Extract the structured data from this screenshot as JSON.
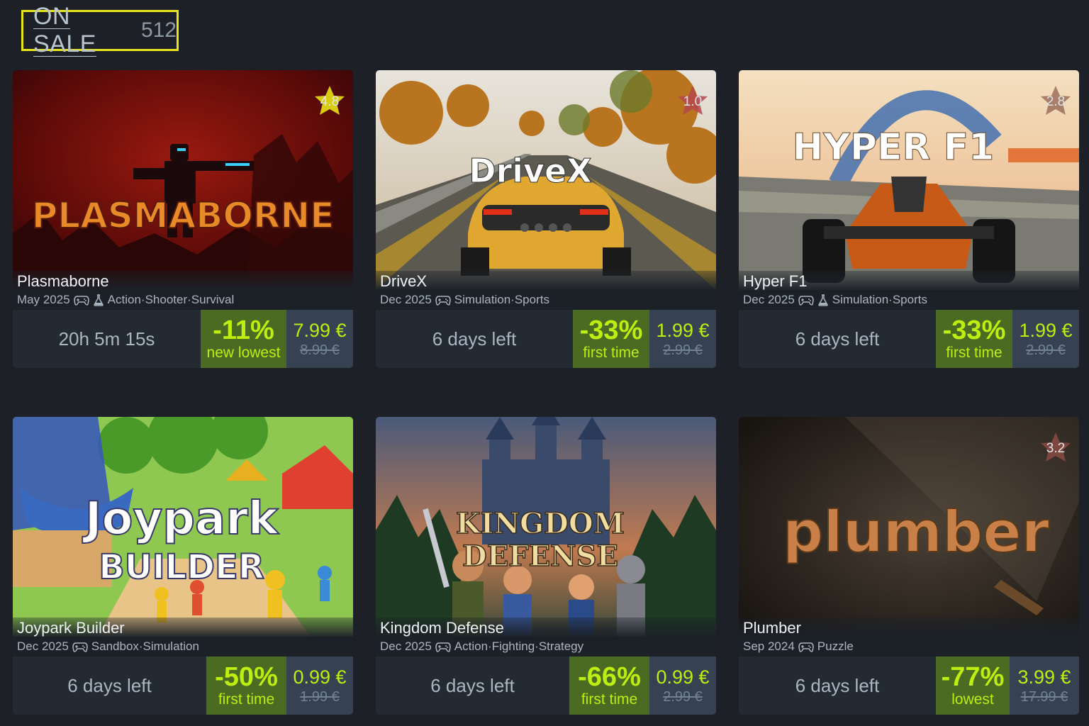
{
  "section": {
    "title": "ON SALE",
    "count": "512"
  },
  "games": [
    {
      "capsule_text": "PLASMABORNE",
      "title": "Plasmaborne",
      "date": "May 2025",
      "has_controller": true,
      "has_early_access": true,
      "tags": "Action·Shooter·Survival",
      "rating": "4.8",
      "rating_color": "#d8cc10",
      "time_left": "20h 5m 15s",
      "discount": "-11%",
      "discount_note": "new lowest",
      "price": "7.99 €",
      "original_price": "8.99 €"
    },
    {
      "capsule_text": "DriveX",
      "title": "DriveX",
      "date": "Dec 2025",
      "has_controller": true,
      "has_early_access": false,
      "tags": "Simulation·Sports",
      "rating": "1.0",
      "rating_color": "#b5484e",
      "time_left": "6 days left",
      "discount": "-33%",
      "discount_note": "first time",
      "price": "1.99 €",
      "original_price": "2.99 €"
    },
    {
      "capsule_text": "HYPER F1",
      "title": "Hyper F1",
      "date": "Dec 2025",
      "has_controller": true,
      "has_early_access": true,
      "tags": "Simulation·Sports",
      "rating": "2.8",
      "rating_color": "#8a5a4a",
      "time_left": "6 days left",
      "discount": "-33%",
      "discount_note": "first time",
      "price": "1.99 €",
      "original_price": "2.99 €"
    },
    {
      "capsule_text": "Joypark",
      "capsule_subtext": "BUILDER",
      "title": "Joypark Builder",
      "date": "Dec 2025",
      "has_controller": true,
      "has_early_access": false,
      "tags": "Sandbox·Simulation",
      "rating": "",
      "time_left": "6 days left",
      "discount": "-50%",
      "discount_note": "first time",
      "price": "0.99 €",
      "original_price": "1.99 €"
    },
    {
      "capsule_text": "KINGDOM",
      "capsule_subtext": "DEFENSE",
      "title": "Kingdom Defense",
      "date": "Dec 2025",
      "has_controller": true,
      "has_early_access": false,
      "tags": "Action·Fighting·Strategy",
      "rating": "",
      "time_left": "6 days left",
      "discount": "-66%",
      "discount_note": "first time",
      "price": "0.99 €",
      "original_price": "2.99 €"
    },
    {
      "capsule_text": "plumber",
      "title": "Plumber",
      "date": "Sep 2024",
      "has_controller": true,
      "has_early_access": false,
      "tags": "Puzzle",
      "rating": "3.2",
      "rating_color": "#8a4a44",
      "time_left": "6 days left",
      "discount": "-77%",
      "discount_note": "lowest",
      "price": "3.99 €",
      "original_price": "17.99 €"
    }
  ]
}
